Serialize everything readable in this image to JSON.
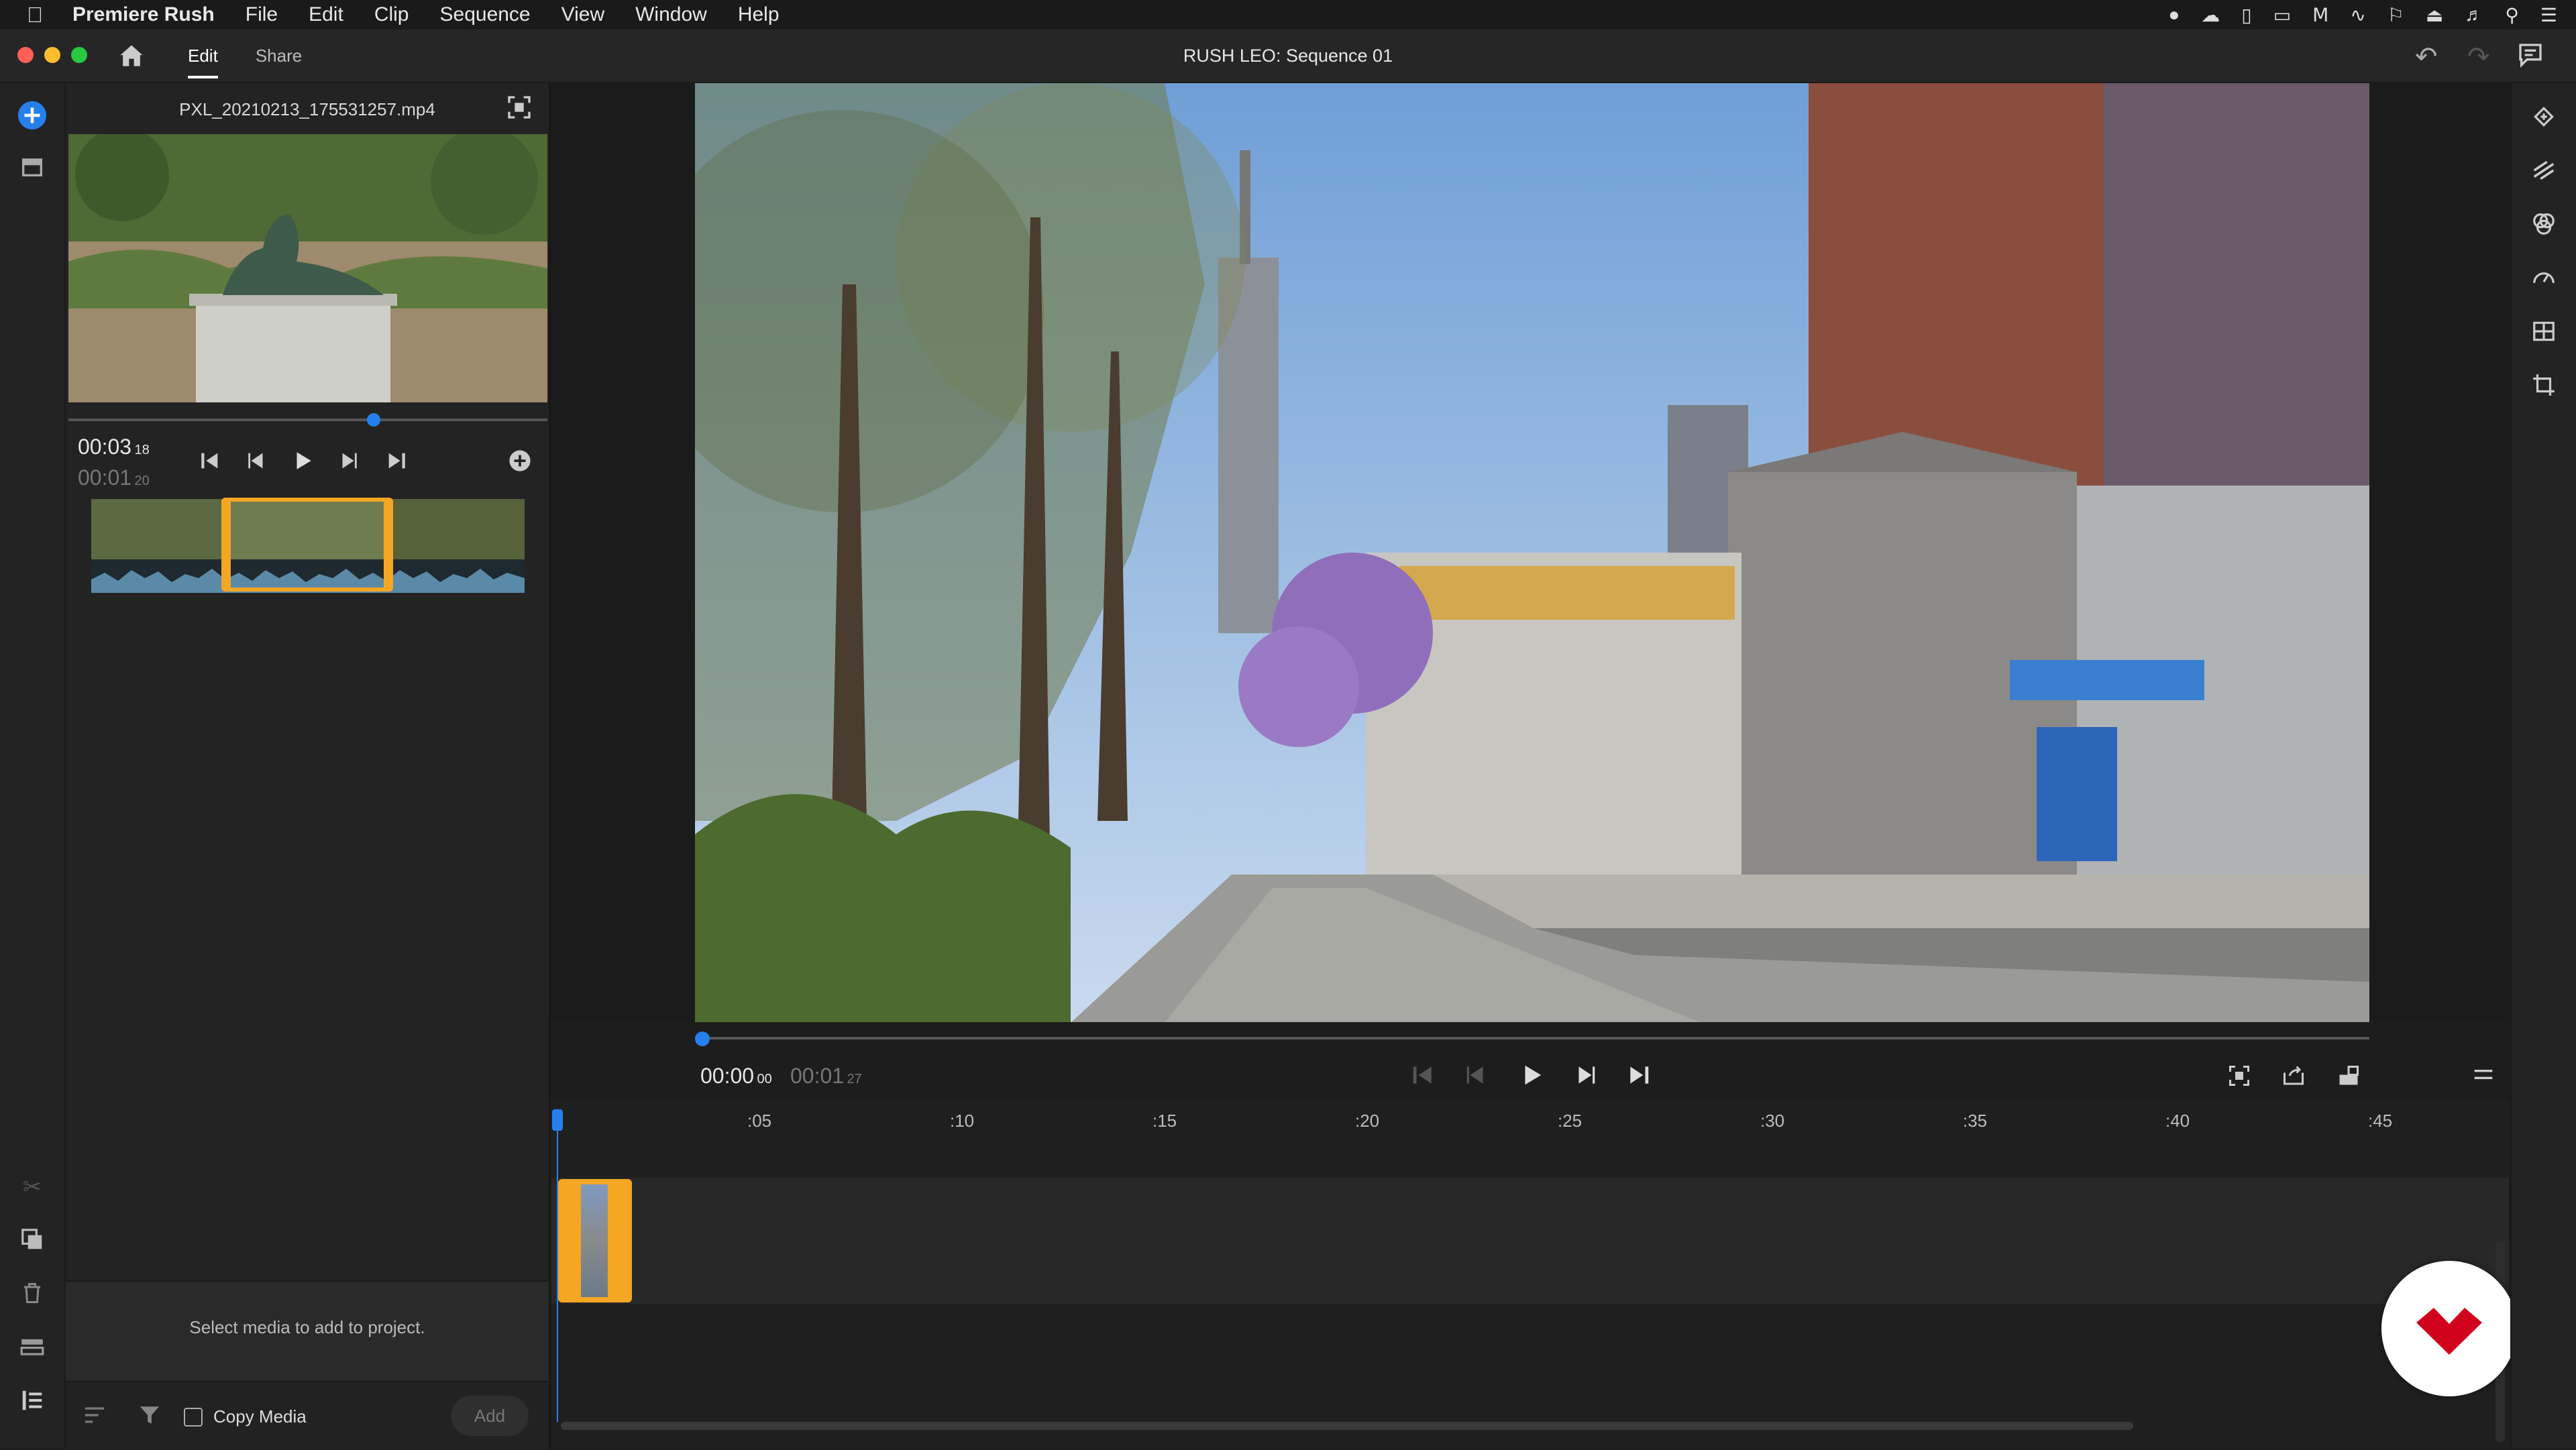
{
  "menubar": {
    "app_name": "Premiere Rush",
    "items": [
      "File",
      "Edit",
      "Clip",
      "Sequence",
      "View",
      "Window",
      "Help"
    ]
  },
  "header": {
    "tabs": [
      {
        "label": "Edit",
        "active": true
      },
      {
        "label": "Share",
        "active": false
      }
    ],
    "sequence_title": "RUSH LEO: Sequence 01"
  },
  "media_panel": {
    "filename": "PXL_20210213_175531257.mp4",
    "current_time": "00:03",
    "current_frames": "18",
    "duration_time": "00:01",
    "duration_frames": "20",
    "playhead_fraction": 0.65,
    "select_message": "Select media to add to project.",
    "copy_media_label": "Copy Media",
    "add_button_label": "Add"
  },
  "program": {
    "current_time": "00:00",
    "current_frames": "00",
    "duration_time": "00:01",
    "duration_frames": "27",
    "playhead_fraction": 0.0
  },
  "timeline": {
    "ruler_marks": [
      ":05",
      ":10",
      ":15",
      ":20",
      ":25",
      ":30",
      ":35",
      ":40",
      ":45"
    ]
  },
  "colors": {
    "accent_blue": "#2680eb",
    "selection_orange": "#f5a623",
    "close": "#ff5f57",
    "minimize": "#febc2e",
    "zoom": "#28c840"
  }
}
